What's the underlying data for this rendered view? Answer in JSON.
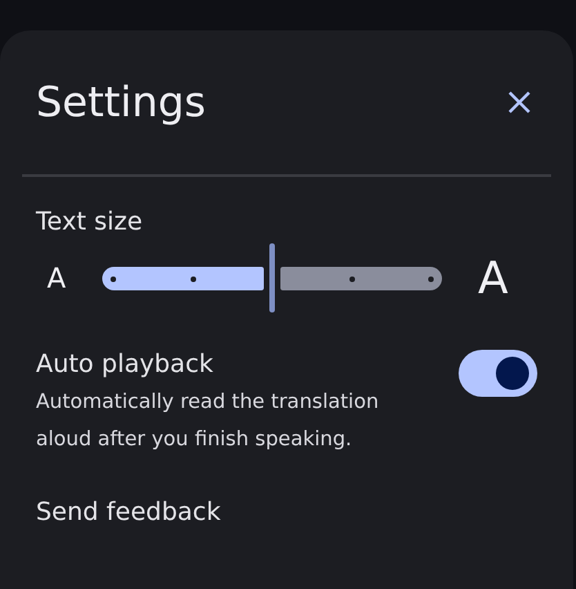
{
  "title": "Settings",
  "text_size": {
    "label": "Text size",
    "small_glyph": "A",
    "large_glyph": "A",
    "level": 0.5
  },
  "auto_playback": {
    "label": "Auto playback",
    "description": "Automatically read the translation aloud after you finish speaking.",
    "on": true
  },
  "send_feedback": "Send feedback"
}
